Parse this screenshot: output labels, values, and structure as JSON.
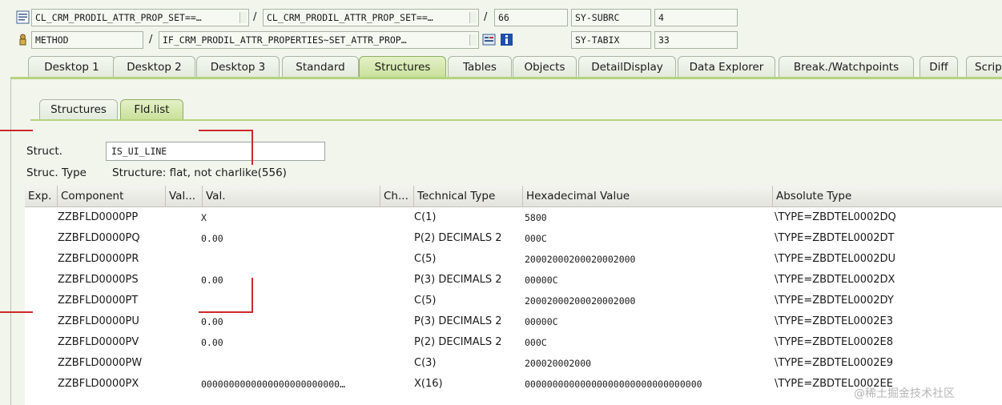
{
  "header": {
    "row1": {
      "field1": "CL_CRM_PRODIL_ATTR_PROP_SET==…",
      "sep1": "/",
      "field2": "CL_CRM_PRODIL_ATTR_PROP_SET==…",
      "sep2": "/",
      "line": "66",
      "sysvar_name": "SY-SUBRC",
      "sysvar_value": "4"
    },
    "row2": {
      "type": "METHOD",
      "sep1": "/",
      "method": "IF_CRM_PRODIL_ATTR_PROPERTIES~SET_ATTR_PROP…",
      "sysvar_name": "SY-TABIX",
      "sysvar_value": "33"
    }
  },
  "tabs": [
    "Desktop 1",
    "Desktop 2",
    "Desktop 3",
    "Standard",
    "Structures",
    "Tables",
    "Objects",
    "DetailDisplay",
    "Data Explorer",
    "Break./Watchpoints",
    "Diff",
    "Scrip"
  ],
  "active_tab": "Structures",
  "subtabs": [
    "Structures",
    "Fld.list"
  ],
  "active_subtab": "Fld.list",
  "struct": {
    "label": "Struct.",
    "value": "IS_UI_LINE",
    "type_label": "Struc. Type",
    "type_value": "Structure: flat, not charlike(556)"
  },
  "table": {
    "columns": [
      "Exp.",
      "Component",
      "Val...",
      "Val.",
      "Ch...",
      "Technical Type",
      "Hexadecimal Value",
      "Absolute Type"
    ],
    "rows": [
      {
        "component": "ZZBFLD0000PP",
        "val": "X",
        "ttype": "C(1)",
        "hex": "5800",
        "abs": "\\TYPE=ZBDTEL0002DQ"
      },
      {
        "component": "ZZBFLD0000PQ",
        "val": "0.00",
        "ttype": "P(2) DECIMALS 2",
        "hex": "000C",
        "abs": "\\TYPE=ZBDTEL0002DT"
      },
      {
        "component": "ZZBFLD0000PR",
        "val": "",
        "ttype": "C(5)",
        "hex": "20002000200020002000",
        "abs": "\\TYPE=ZBDTEL0002DU"
      },
      {
        "component": "ZZBFLD0000PS",
        "val": "0.00",
        "ttype": "P(3) DECIMALS 2",
        "hex": "00000C",
        "abs": "\\TYPE=ZBDTEL0002DX"
      },
      {
        "component": "ZZBFLD0000PT",
        "val": "",
        "ttype": "C(5)",
        "hex": "20002000200020002000",
        "abs": "\\TYPE=ZBDTEL0002DY"
      },
      {
        "component": "ZZBFLD0000PU",
        "val": "0.00",
        "ttype": "P(3) DECIMALS 2",
        "hex": "00000C",
        "abs": "\\TYPE=ZBDTEL0002E3"
      },
      {
        "component": "ZZBFLD0000PV",
        "val": "0.00",
        "ttype": "P(2) DECIMALS 2",
        "hex": "000C",
        "abs": "\\TYPE=ZBDTEL0002E8"
      },
      {
        "component": "ZZBFLD0000PW",
        "val": "",
        "ttype": "C(3)",
        "hex": "200020002000",
        "abs": "\\TYPE=ZBDTEL0002E9"
      },
      {
        "component": "ZZBFLD0000PX",
        "val": "0000000000000000000000000…",
        "ttype": "X(16)",
        "hex": "00000000000000000000000000000000",
        "abs": "\\TYPE=ZBDTEL0002EE"
      }
    ]
  },
  "watermark": "@稀土掘金技术社区",
  "colors": {
    "active_tab": "#c9e09a",
    "accent_line": "#b5d37f",
    "annotation": "#cc2a2a"
  },
  "icons": [
    "editor-icon",
    "method-icon",
    "display-icon",
    "info-icon"
  ]
}
